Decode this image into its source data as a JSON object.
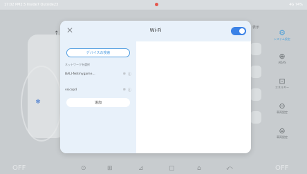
{
  "status_bar": {
    "left_text": "17:02 PM2.5 Inside7 Outside23",
    "right_text": "4G 74%"
  },
  "background": {
    "behind_label": "表示",
    "rail": [
      {
        "icon": "settings-icon",
        "glyph": "⚙",
        "label": "システム設定",
        "active": true
      },
      {
        "icon": "adas-icon",
        "glyph": "⊕",
        "label": "ADAS",
        "active": false
      },
      {
        "icon": "energy-icon",
        "glyph": "⊡",
        "label": "エネルギー",
        "active": false
      },
      {
        "icon": "vehicle-icon",
        "glyph": "⊖",
        "label": "車両設定",
        "active": false
      },
      {
        "icon": "vehicle-settings-icon",
        "glyph": "⊜",
        "label": "車両設定",
        "active": false
      }
    ],
    "off_left": "OFF",
    "off_right": "OFF",
    "bottom_icons": [
      "⊙",
      "⊞",
      "⊿",
      "▢",
      "⌂",
      "⤺"
    ]
  },
  "dialog": {
    "title": "Wi-Fi",
    "close_glyph": "✕",
    "search_button": "デバイスの検索",
    "section_label": "ネットワークを選択",
    "networks": [
      {
        "name": "BALI-Netmygame...",
        "signal": "≋",
        "info": "ⓘ"
      },
      {
        "name": "vsicxpd",
        "signal": "≋",
        "info": "ⓘ"
      }
    ],
    "add_button": "追加",
    "wifi_enabled": true,
    "accent_color": "#3b82e6"
  }
}
